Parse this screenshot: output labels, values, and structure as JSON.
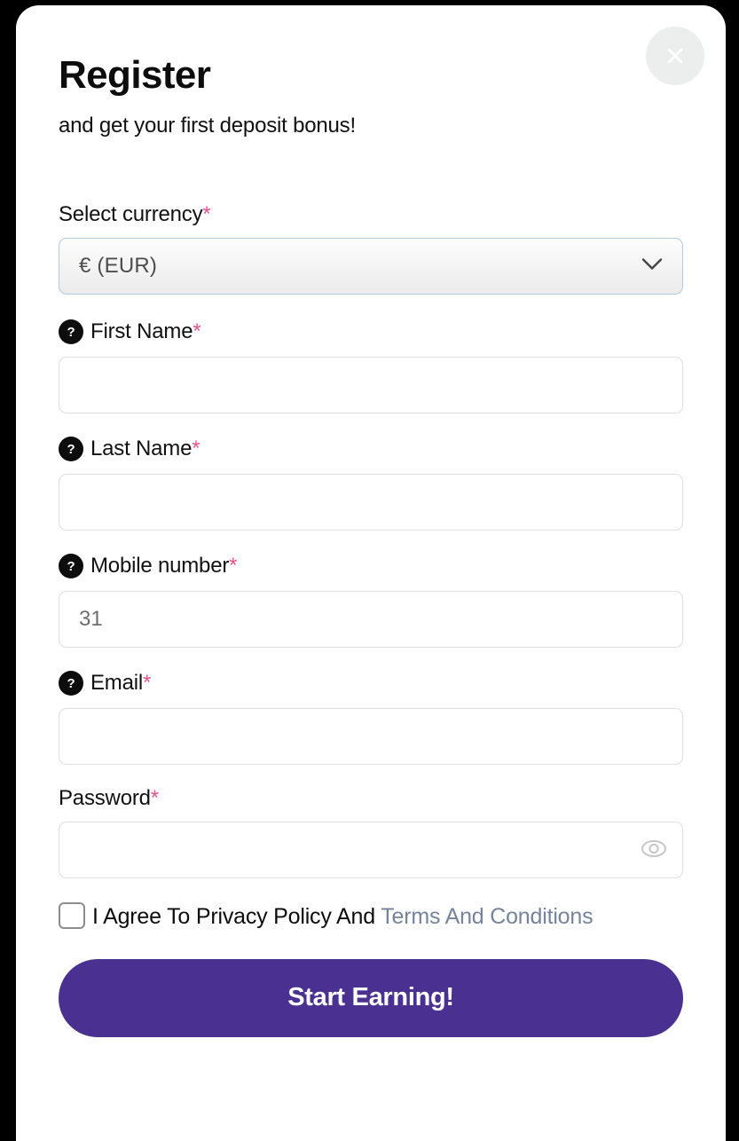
{
  "modal": {
    "title": "Register",
    "subtitle": "and get your first deposit bonus!",
    "close_label": "close-icon"
  },
  "form": {
    "currency": {
      "label": "Select currency",
      "required_mark": "*",
      "selected": "€ (EUR)",
      "options": [
        "€ (EUR)"
      ]
    },
    "first_name": {
      "label": "First Name",
      "required_mark": "*",
      "help": "?",
      "value": "",
      "placeholder": ""
    },
    "last_name": {
      "label": "Last Name",
      "required_mark": "*",
      "help": "?",
      "value": "",
      "placeholder": ""
    },
    "mobile": {
      "label": "Mobile number",
      "required_mark": "*",
      "help": "?",
      "value": "31",
      "placeholder": "31"
    },
    "email": {
      "label": "Email",
      "required_mark": "*",
      "help": "?",
      "value": "",
      "placeholder": ""
    },
    "password": {
      "label": "Password",
      "required_mark": "*",
      "value": "",
      "placeholder": "",
      "toggle": "eye-icon"
    },
    "terms": {
      "checked": false,
      "text_before": "I Agree To Privacy Policy And ",
      "link_text": "Terms And Conditions"
    },
    "submit_label": "Start Earning!"
  },
  "colors": {
    "brand_purple": "#4a3191",
    "required_pink": "#e8518c",
    "link_slate": "#76839b",
    "select_border": "#b3cadd",
    "input_border": "#dededf",
    "close_bg": "#eceded"
  }
}
